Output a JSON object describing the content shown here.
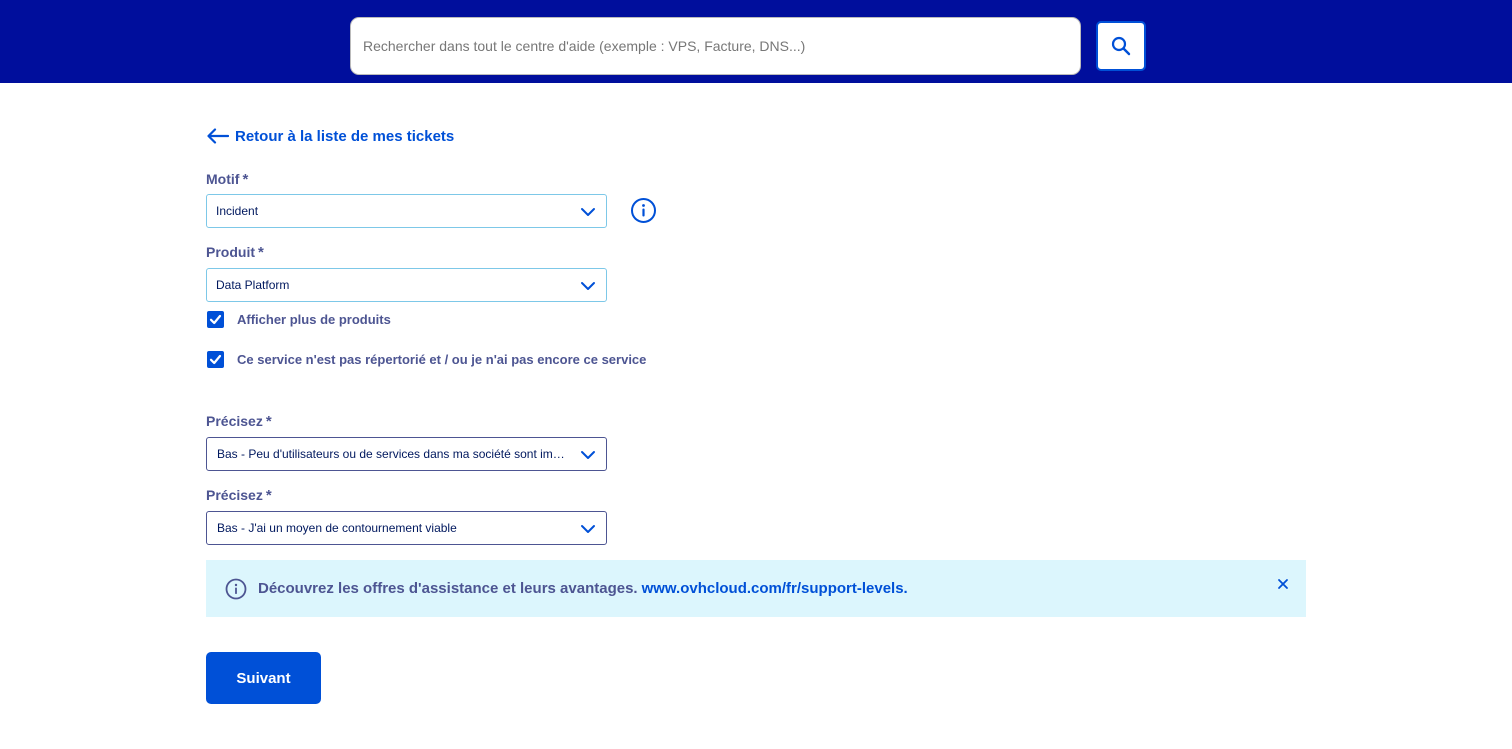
{
  "header": {
    "search_placeholder": "Rechercher dans tout le centre d'aide (exemple : VPS, Facture, DNS...)",
    "search_icon": "magnifier-icon"
  },
  "back_link": {
    "label": "Retour à la liste de mes tickets"
  },
  "form": {
    "required_mark": "*",
    "motif": {
      "label": "Motif",
      "value": "Incident"
    },
    "produit": {
      "label": "Produit",
      "value": "Data Platform"
    },
    "checkboxes": [
      {
        "label": "Afficher plus de produits",
        "checked": true
      },
      {
        "label": "Ce service n'est pas répertorié et / ou je n'ai pas encore ce service",
        "checked": true
      }
    ],
    "precisez_1": {
      "label": "Précisez",
      "value": "Bas - Peu d'utilisateurs ou de services dans ma société sont impactés"
    },
    "precisez_2": {
      "label": "Précisez",
      "value": "Bas - J'ai un moyen de contournement viable"
    }
  },
  "banner": {
    "text": "Découvrez les offres d'assistance et leurs avantages.",
    "link": "www.ovhcloud.com/fr/support-levels."
  },
  "actions": {
    "next_label": "Suivant"
  },
  "colors": {
    "header_bg": "#000e9c",
    "primary": "#0050d7",
    "text": "#4d5592",
    "banner_bg": "#dcf6fd"
  }
}
